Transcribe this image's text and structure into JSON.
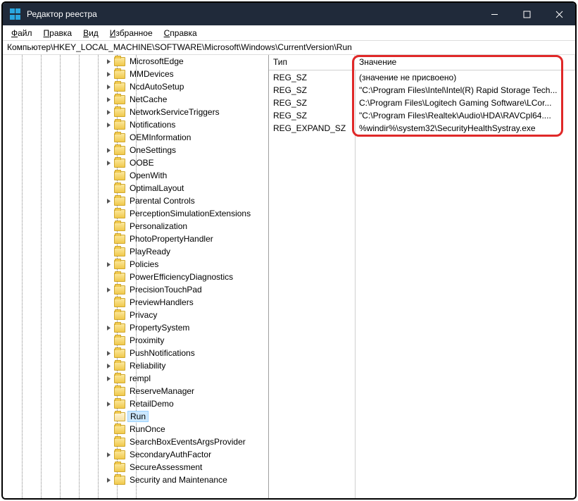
{
  "title": "Редактор реестра",
  "menu": [
    "Файл",
    "Правка",
    "Вид",
    "Избранное",
    "Справка"
  ],
  "path": "Компьютер\\HKEY_LOCAL_MACHINE\\SOFTWARE\\Microsoft\\Windows\\CurrentVersion\\Run",
  "cols": {
    "type": "Тип",
    "value": "Значение"
  },
  "tree_depth": 7,
  "tree": [
    {
      "l": "MicrosoftEdge",
      "c": true
    },
    {
      "l": "MMDevices",
      "c": true
    },
    {
      "l": "NcdAutoSetup",
      "c": true
    },
    {
      "l": "NetCache",
      "c": true
    },
    {
      "l": "NetworkServiceTriggers",
      "c": true
    },
    {
      "l": "Notifications",
      "c": true
    },
    {
      "l": "OEMInformation",
      "c": false
    },
    {
      "l": "OneSettings",
      "c": true
    },
    {
      "l": "OOBE",
      "c": true
    },
    {
      "l": "OpenWith",
      "c": false
    },
    {
      "l": "OptimalLayout",
      "c": false
    },
    {
      "l": "Parental Controls",
      "c": true
    },
    {
      "l": "PerceptionSimulationExtensions",
      "c": false
    },
    {
      "l": "Personalization",
      "c": false
    },
    {
      "l": "PhotoPropertyHandler",
      "c": false
    },
    {
      "l": "PlayReady",
      "c": false
    },
    {
      "l": "Policies",
      "c": true
    },
    {
      "l": "PowerEfficiencyDiagnostics",
      "c": false
    },
    {
      "l": "PrecisionTouchPad",
      "c": true
    },
    {
      "l": "PreviewHandlers",
      "c": false
    },
    {
      "l": "Privacy",
      "c": false
    },
    {
      "l": "PropertySystem",
      "c": true
    },
    {
      "l": "Proximity",
      "c": false
    },
    {
      "l": "PushNotifications",
      "c": true
    },
    {
      "l": "Reliability",
      "c": true
    },
    {
      "l": "rempl",
      "c": true
    },
    {
      "l": "ReserveManager",
      "c": false
    },
    {
      "l": "RetailDemo",
      "c": true
    },
    {
      "l": "Run",
      "c": false,
      "sel": true
    },
    {
      "l": "RunOnce",
      "c": false
    },
    {
      "l": "SearchBoxEventsArgsProvider",
      "c": false
    },
    {
      "l": "SecondaryAuthFactor",
      "c": true
    },
    {
      "l": "SecureAssessment",
      "c": false
    },
    {
      "l": "Security and Maintenance",
      "c": true
    }
  ],
  "rows": [
    {
      "t": "REG_SZ",
      "v": "(значение не присвоено)"
    },
    {
      "t": "REG_SZ",
      "v": "\"C:\\Program Files\\Intel\\Intel(R) Rapid Storage Tech..."
    },
    {
      "t": "REG_SZ",
      "v": "C:\\Program Files\\Logitech Gaming Software\\LCor..."
    },
    {
      "t": "REG_SZ",
      "v": "\"C:\\Program Files\\Realtek\\Audio\\HDA\\RAVCpl64...."
    },
    {
      "t": "REG_EXPAND_SZ",
      "v": "%windir%\\system32\\SecurityHealthSystray.exe"
    }
  ]
}
